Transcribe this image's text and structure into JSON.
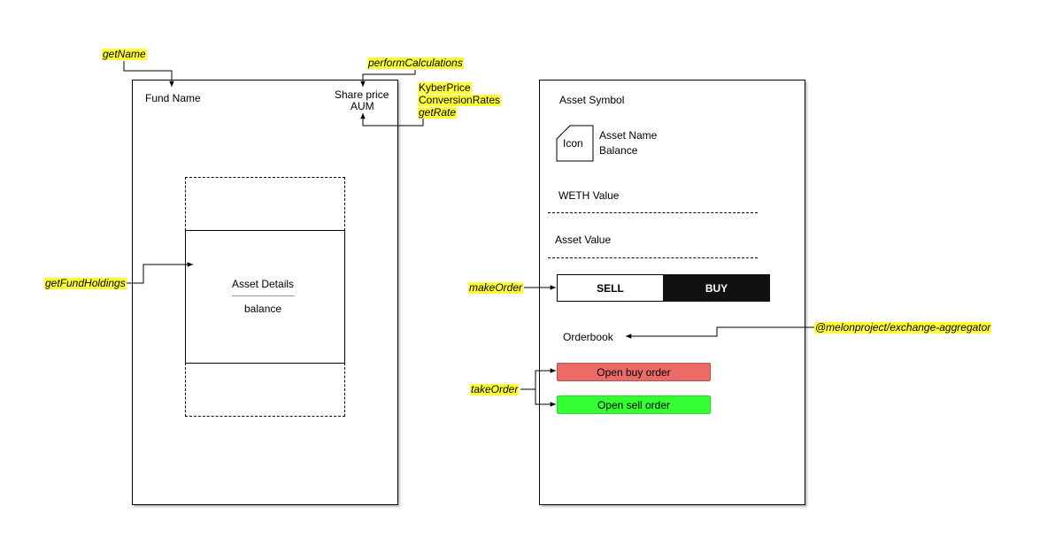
{
  "colors": {
    "highlight": "#ffff33",
    "buy_button_bg": "#111111",
    "open_buy_order_bg": "#ea6b66",
    "open_sell_order_bg": "#33ff33"
  },
  "left_panel": {
    "fund_name": "Fund Name",
    "share_price": "Share price",
    "aum": "AUM",
    "asset_details": "Asset Details",
    "balance": "balance"
  },
  "right_panel": {
    "asset_symbol": "Asset Symbol",
    "icon_label": "Icon",
    "asset_name": "Asset Name",
    "balance": "Balance",
    "weth_value": "WETH Value",
    "asset_value": "Asset Value",
    "sell_label": "SELL",
    "buy_label": "BUY",
    "orderbook": "Orderbook",
    "open_buy_order": "Open buy order",
    "open_sell_order": "Open sell order"
  },
  "annotations": {
    "get_name": "getName",
    "perform_calculations": "performCalculations",
    "kyber_price": "KyberPrice",
    "conversion_rates": "ConversionRates",
    "get_rate": "getRate",
    "get_fund_holdings": "getFundHoldings",
    "make_order": "makeOrder",
    "take_order": "takeOrder",
    "exchange_aggregator": "@melonproject/exchange-aggregator"
  }
}
